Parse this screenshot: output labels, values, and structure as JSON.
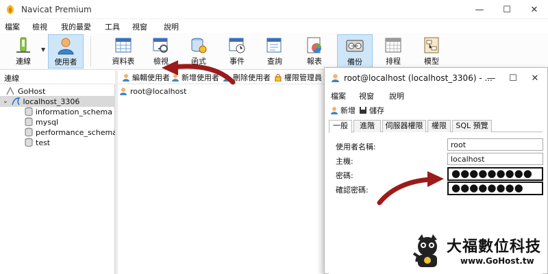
{
  "app": {
    "title": "Navicat Premium"
  },
  "window_controls": {
    "minimize": "—",
    "maximize": "☐",
    "close": "✕"
  },
  "menu": [
    "檔案",
    "檢視",
    "我的最愛",
    "工具",
    "視窗",
    "說明"
  ],
  "toolbar": [
    {
      "label": "連線",
      "icon": "connection-icon"
    },
    {
      "label": "使用者",
      "icon": "user-icon",
      "active": true
    },
    {
      "label": "資料表",
      "icon": "table-icon"
    },
    {
      "label": "檢視",
      "icon": "view-icon"
    },
    {
      "label": "函式",
      "icon": "function-icon"
    },
    {
      "label": "事件",
      "icon": "event-icon"
    },
    {
      "label": "查詢",
      "icon": "query-icon"
    },
    {
      "label": "報表",
      "icon": "report-icon"
    },
    {
      "label": "備份",
      "icon": "backup-icon",
      "active": true
    },
    {
      "label": "排程",
      "icon": "schedule-icon"
    },
    {
      "label": "模型",
      "icon": "model-icon"
    }
  ],
  "sidebar": {
    "header": "連線",
    "tree": [
      {
        "label": "GoHost",
        "level": 0
      },
      {
        "label": "localhost_3306",
        "level": 0,
        "expanded": true,
        "selected": true
      },
      {
        "label": "information_schema",
        "level": 1
      },
      {
        "label": "mysql",
        "level": 1
      },
      {
        "label": "performance_schema",
        "level": 1
      },
      {
        "label": "test",
        "level": 1
      }
    ]
  },
  "user_toolbar": {
    "edit": "編輯使用者",
    "new": "新增使用者",
    "delete": "刪除使用者",
    "privilege": "權限管理員"
  },
  "users": [
    "root@localhost"
  ],
  "dialog": {
    "title": "root@localhost (localhost_3306) - ...",
    "menu": [
      "檔案",
      "視窗",
      "說明"
    ],
    "tools": {
      "new": "新增",
      "save": "儲存"
    },
    "tabs": [
      "一般",
      "進階",
      "伺服器權限",
      "權限",
      "SQL 預覽"
    ],
    "fields": {
      "username_label": "使用者名稱:",
      "username_value": "root",
      "host_label": "主機:",
      "host_value": "localhost",
      "password_label": "密碼:",
      "password_value": "●●●●●●●●●",
      "confirm_label": "確認密碼:",
      "confirm_value": "●●●●●●●●"
    }
  },
  "brand": {
    "name": "大福數位科技",
    "url": "www.GoHost.tw"
  },
  "colors": {
    "arrow": "#9b1b1b",
    "active_bg": "#cfe6f9",
    "accent": "#1e70c8"
  }
}
